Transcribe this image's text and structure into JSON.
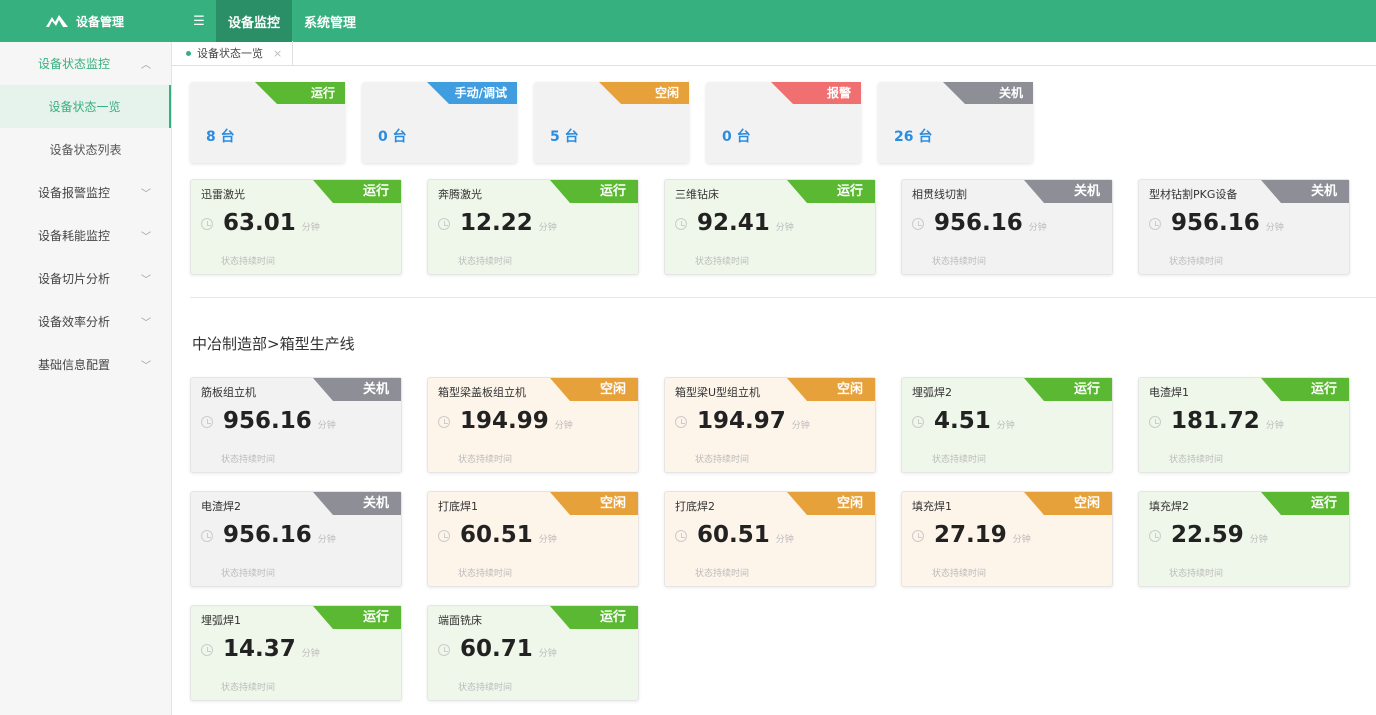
{
  "app": {
    "title": "设备管理"
  },
  "topnav": [
    "设备监控",
    "系统管理"
  ],
  "sidebar": {
    "items": [
      {
        "label": "设备状态监控",
        "expanded": true,
        "children": [
          "设备状态一览",
          "设备状态列表"
        ]
      },
      {
        "label": "设备报警监控"
      },
      {
        "label": "设备耗能监控"
      },
      {
        "label": "设备切片分析"
      },
      {
        "label": "设备效率分析"
      },
      {
        "label": "基础信息配置"
      }
    ]
  },
  "tab": {
    "label": "设备状态一览",
    "close": "×"
  },
  "summary": [
    {
      "status": "运行",
      "count": "8 台",
      "color": "#5bb832"
    },
    {
      "status": "手动/调试",
      "count": "0 台",
      "color": "#3f9de0"
    },
    {
      "status": "空闲",
      "count": "5 台",
      "color": "#e7a13b"
    },
    {
      "status": "报警",
      "count": "0 台",
      "color": "#f07072"
    },
    {
      "status": "关机",
      "count": "26 台",
      "color": "#8e8e96"
    }
  ],
  "common": {
    "unit": "分钟",
    "sub": "状态持续时间"
  },
  "colors": {
    "运行": "#5bb832",
    "空闲": "#e7a13b",
    "关机": "#8e8e96",
    "运行_bg": "#eff7ea",
    "空闲_bg": "#fdf4ea",
    "关机_bg": "#f2f2f2"
  },
  "group1": [
    {
      "name": "迅雷激光",
      "status": "运行",
      "value": "63.01"
    },
    {
      "name": "奔腾激光",
      "status": "运行",
      "value": "12.22"
    },
    {
      "name": "三维钻床",
      "status": "运行",
      "value": "92.41"
    },
    {
      "name": "相贯线切割",
      "status": "关机",
      "value": "956.16"
    },
    {
      "name": "型材钻割PKG设备",
      "status": "关机",
      "value": "956.16"
    }
  ],
  "section": {
    "title": "中冶制造部>箱型生产线"
  },
  "group2": [
    {
      "name": "筋板组立机",
      "status": "关机",
      "value": "956.16"
    },
    {
      "name": "箱型梁盖板组立机",
      "status": "空闲",
      "value": "194.99"
    },
    {
      "name": "箱型梁U型组立机",
      "status": "空闲",
      "value": "194.97"
    },
    {
      "name": "埋弧焊2",
      "status": "运行",
      "value": "4.51"
    },
    {
      "name": "电渣焊1",
      "status": "运行",
      "value": "181.72"
    },
    {
      "name": "电渣焊2",
      "status": "关机",
      "value": "956.16"
    },
    {
      "name": "打底焊1",
      "status": "空闲",
      "value": "60.51"
    },
    {
      "name": "打底焊2",
      "status": "空闲",
      "value": "60.51"
    },
    {
      "name": "填充焊1",
      "status": "空闲",
      "value": "27.19"
    },
    {
      "name": "填充焊2",
      "status": "运行",
      "value": "22.59"
    },
    {
      "name": "埋弧焊1",
      "status": "运行",
      "value": "14.37"
    },
    {
      "name": "端面铣床",
      "status": "运行",
      "value": "60.71"
    }
  ]
}
